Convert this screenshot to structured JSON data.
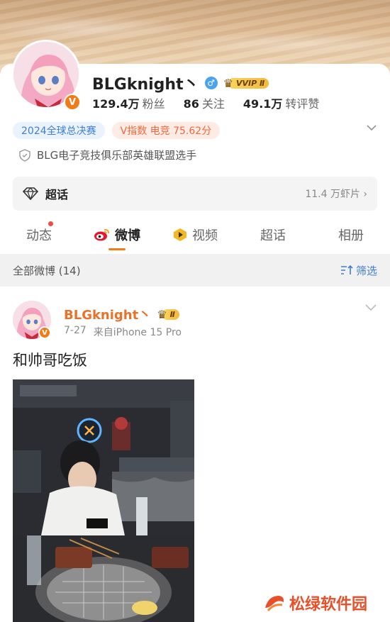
{
  "profile": {
    "username": "BLGknight丶",
    "vip_badge": "VVIP Ⅱ",
    "stats": [
      {
        "num": "129.4万",
        "label": "粉丝"
      },
      {
        "num": "86",
        "label": "关注"
      },
      {
        "num": "49.1万",
        "label": "转评赞"
      }
    ],
    "tags": [
      "2024全球总决赛",
      "V指数 电竞 75.62分"
    ],
    "verification": "BLG电子竞技俱乐部英雄联盟选手"
  },
  "supertopic": {
    "label": "超话",
    "count": "11.4 万虾片 ›"
  },
  "tabs": [
    {
      "label": "动态"
    },
    {
      "label": "微博"
    },
    {
      "label": "视频"
    },
    {
      "label": "超话"
    },
    {
      "label": "相册"
    }
  ],
  "filter": {
    "title": "全部微博 (14)",
    "button": "筛选"
  },
  "post": {
    "username": "BLGknight丶",
    "badge": "Ⅱ",
    "date": "7-27",
    "source": "来自iPhone 15 Pro",
    "text": "和帅哥吃饭"
  },
  "watermark": {
    "text": "松绿软件园"
  },
  "colors": {
    "accent": "#f07c17",
    "link": "#3d7fd3",
    "post_name": "#e8722a"
  }
}
